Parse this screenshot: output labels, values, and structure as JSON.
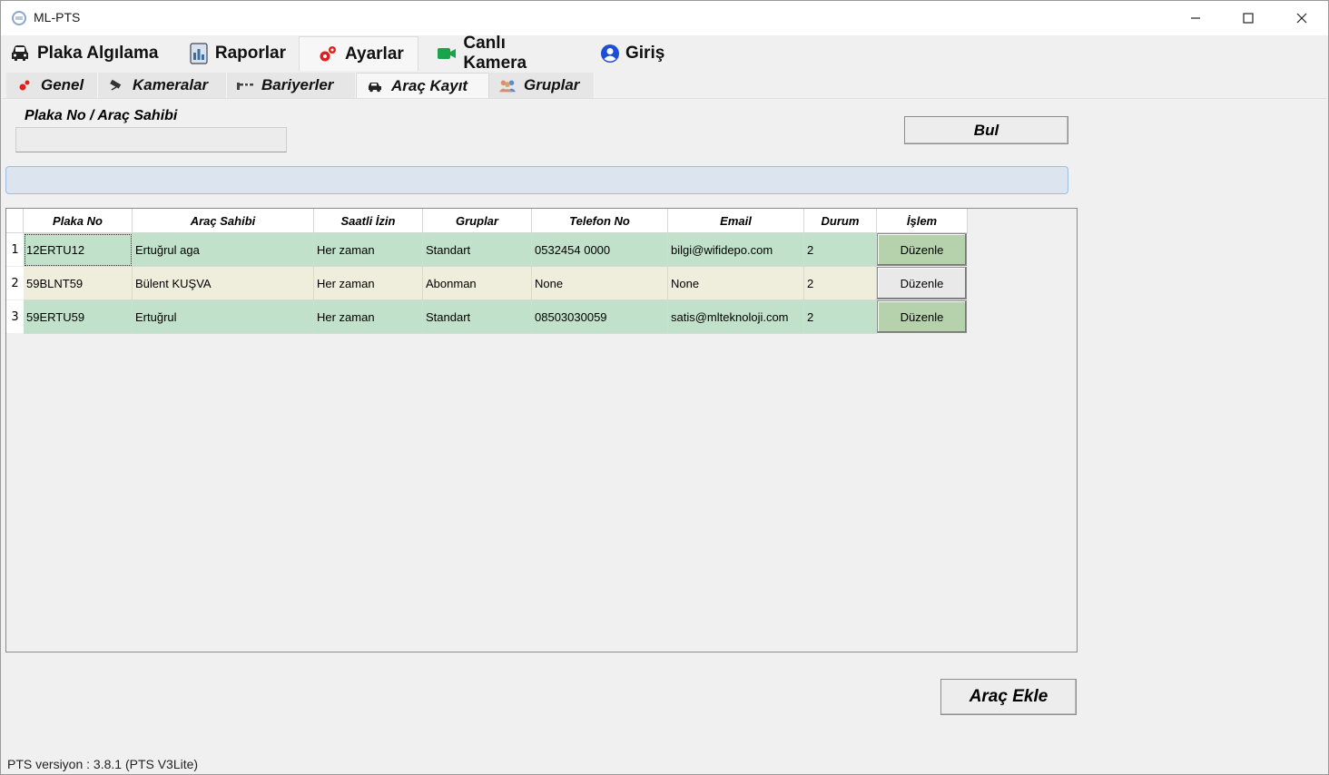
{
  "window": {
    "title": "ML-PTS"
  },
  "main_tabs": [
    {
      "label": "Plaka Algılama",
      "icon": "car-icon"
    },
    {
      "label": "Raporlar",
      "icon": "report-icon"
    },
    {
      "label": "Ayarlar",
      "icon": "gears-icon",
      "active": true
    },
    {
      "label": "Canlı Kamera",
      "icon": "video-camera-icon"
    },
    {
      "label": "Giriş",
      "icon": "user-icon"
    }
  ],
  "sub_tabs": [
    {
      "label": "Genel",
      "icon": "gears-icon"
    },
    {
      "label": "Kameralar",
      "icon": "camera-icon"
    },
    {
      "label": "Bariyerler",
      "icon": "barrier-icon"
    },
    {
      "label": "Araç Kayıt",
      "icon": "car-register-icon",
      "active": true
    },
    {
      "label": "Gruplar",
      "icon": "group-icon"
    }
  ],
  "search": {
    "label": "Plaka No / Araç Sahibi",
    "value": "",
    "button_label": "Bul"
  },
  "info_bar": {
    "text": ""
  },
  "table": {
    "columns": [
      "Plaka No",
      "Araç Sahibi",
      "Saatli İzin",
      "Gruplar",
      "Telefon No",
      "Email",
      "Durum",
      "İşlem"
    ],
    "rows": [
      {
        "num": "1",
        "plaka": "12ERTU12",
        "sahibi": "Ertuğrul aga",
        "izin": "Her zaman",
        "grup": "Standart",
        "telefon": "0532454 0000",
        "email": "bilgi@wifidepo.com",
        "durum": "2",
        "islem": "Düzenle"
      },
      {
        "num": "2",
        "plaka": "59BLNT59",
        "sahibi": "Bülent KUŞVA",
        "izin": "Her zaman",
        "grup": "Abonman",
        "telefon": "None",
        "email": "None",
        "durum": "2",
        "islem": "Düzenle"
      },
      {
        "num": "3",
        "plaka": "59ERTU59",
        "sahibi": "Ertuğrul",
        "izin": "Her zaman",
        "grup": "Standart",
        "telefon": "08503030059",
        "email": "satis@mlteknoloji.com",
        "durum": "2",
        "islem": "Düzenle"
      }
    ]
  },
  "add_button_label": "Araç Ekle",
  "footer": {
    "version": "PTS versiyon : 3.8.1 (PTS V3Lite)"
  },
  "colors": {
    "row_green": "#c2e1cb",
    "row_beige": "#efeedc",
    "info_bar": "#dce5ef"
  }
}
